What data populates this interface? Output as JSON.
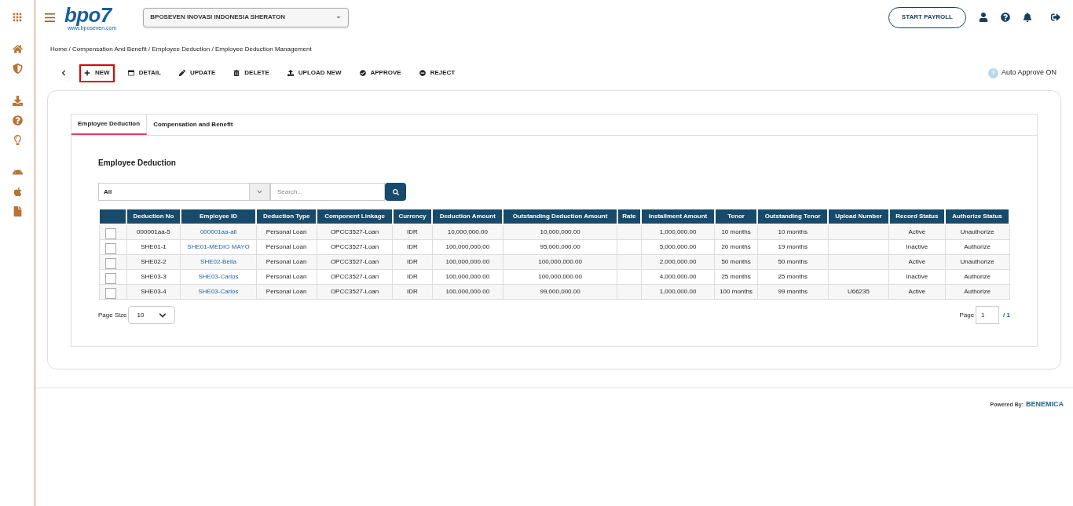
{
  "header": {
    "logo": "bpo7",
    "logo_caption": "www.bposeven.com",
    "company_select": {
      "value": "BPOSEVEN INOVASI INDONESIA SHERATON"
    },
    "start_button": "START PAYROLL"
  },
  "breadcrumb": "Home / Compensation And Benefit / Employee Deduction / Employee Deduction Management",
  "toolbar": [
    {
      "label": "NEW",
      "selected": true
    },
    {
      "label": "DETAIL",
      "selected": false
    },
    {
      "label": "UPDATE",
      "selected": false
    },
    {
      "label": "DELETE",
      "selected": false
    },
    {
      "label": "UPLOAD NEW",
      "selected": false
    },
    {
      "label": "APPROVE",
      "selected": false
    },
    {
      "label": "REJECT",
      "selected": false
    }
  ],
  "auto_approve": {
    "icon_text": "?",
    "label": "Auto Approve ON"
  },
  "tabs": [
    {
      "label": "Employee Deduction",
      "selected": true
    },
    {
      "label": "Compensation and Benefit",
      "selected": false
    }
  ],
  "section_title": "Employee Deduction",
  "filter": {
    "value": "All"
  },
  "search": {
    "placeholder": "Search..."
  },
  "table": {
    "columns": [
      {
        "label": "Deduction No",
        "kind": "text"
      },
      {
        "label": "Employee ID",
        "kind": "link"
      },
      {
        "label": "Deduction Type",
        "kind": "text"
      },
      {
        "label": "Component Linkage",
        "kind": "text"
      },
      {
        "label": "Currency",
        "kind": "text"
      },
      {
        "label": "Deduction Amount",
        "kind": "text"
      },
      {
        "label": "Outstanding Deduction Amount",
        "kind": "text"
      },
      {
        "label": "Rate",
        "kind": "text"
      },
      {
        "label": "Installment Amount",
        "kind": "text"
      },
      {
        "label": "Tenor",
        "kind": "text"
      },
      {
        "label": "Outstanding Tenor",
        "kind": "text"
      },
      {
        "label": "Upload Number",
        "kind": "text"
      },
      {
        "label": "Record Status",
        "kind": "text"
      },
      {
        "label": "Authorize Status",
        "kind": "text"
      }
    ],
    "rows": [
      {
        "checked": false,
        "cells": [
          "000001aa-5",
          "000001aa-all",
          "Personal Loan",
          "OPCC3527-Loan",
          "IDR",
          "10,000,000.00",
          "10,000,000.00",
          null,
          "1,000,000.00",
          "10 months",
          "10 months",
          null,
          "Active",
          "Unauthorize"
        ]
      },
      {
        "checked": false,
        "cells": [
          "SHE01-1",
          "SHE01-MEDIO MAYO",
          "Personal Loan",
          "OPCC3527-Loan",
          "IDR",
          "100,000,000.00",
          "95,000,000.00",
          null,
          "5,000,000.00",
          "20 months",
          "19 months",
          null,
          "Inactive",
          "Authorize"
        ]
      },
      {
        "checked": false,
        "cells": [
          "SHE02-2",
          "SHE02-Bella",
          "Personal Loan",
          "OPCC3527-Loan",
          "IDR",
          "100,000,000.00",
          "100,000,000.00",
          null,
          "2,000,000.00",
          "50 months",
          "50 months",
          null,
          "Active",
          "Unauthorize"
        ]
      },
      {
        "checked": false,
        "cells": [
          "SHE03-3",
          "SHE03-Carlos",
          "Personal Loan",
          "OPCC3527-Loan",
          "IDR",
          "100,000,000.00",
          "100,000,000.00",
          null,
          "4,000,000.00",
          "25 months",
          "25 months",
          null,
          "Inactive",
          "Authorize"
        ]
      },
      {
        "checked": false,
        "cells": [
          "SHE03-4",
          "SHE03-Carlos",
          "Personal Loan",
          "OPCC3527-Loan",
          "IDR",
          "100,000,000.00",
          "99,000,000.00",
          null,
          "1,000,000.00",
          "100 months",
          "99 months",
          "U66235",
          "Active",
          "Authorize"
        ]
      }
    ]
  },
  "page_size": {
    "label": "Page Size",
    "value": "10"
  },
  "pagination": {
    "label": "Page",
    "value": "1",
    "total": "/ 1"
  },
  "footer": {
    "powered_by": "Powered By:",
    "brand": "BENEMICA"
  }
}
